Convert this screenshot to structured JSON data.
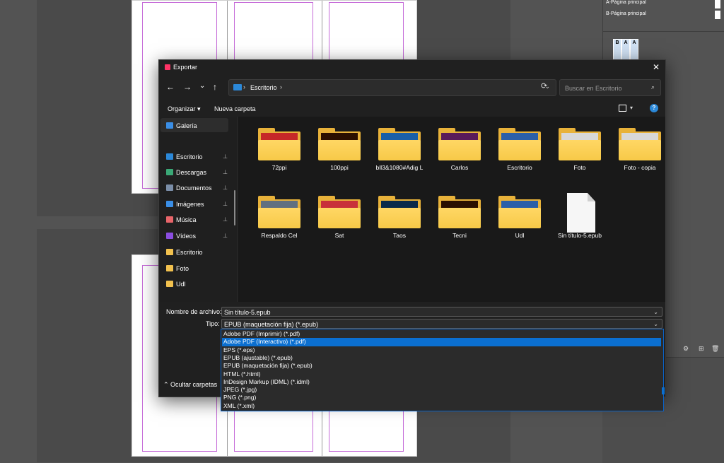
{
  "background": {
    "right_panel_rows": [
      "A-Página principal",
      "B-Página principal"
    ],
    "page_thumbs": [
      "B",
      "A",
      "A"
    ]
  },
  "dialog": {
    "title": "Exportar",
    "close": "✕",
    "nav": {
      "back": "←",
      "forward": "→",
      "recent": "⌄",
      "up": "↑"
    },
    "address": {
      "crumb": "Escritorio",
      "sep1": "›",
      "sep2": "›",
      "dropdown": "⌄",
      "refresh": "⟳"
    },
    "search": {
      "placeholder": "Buscar en Escritorio",
      "icon": "⌕"
    },
    "toolbar": {
      "organize": "Organizar ▾",
      "new_folder": "Nueva carpeta",
      "view_chev": "▾",
      "help": "?"
    },
    "sidebar": {
      "items": [
        {
          "label": "Galería",
          "pinned": false,
          "color": "#3a8ee6"
        },
        {
          "label": "Escritorio",
          "pinned": true,
          "color": "#2b88d8"
        },
        {
          "label": "Descargas",
          "pinned": true,
          "color": "#3aa876"
        },
        {
          "label": "Documentos",
          "pinned": true,
          "color": "#7b8ea8"
        },
        {
          "label": "Imágenes",
          "pinned": true,
          "color": "#3a8ee6"
        },
        {
          "label": "Música",
          "pinned": true,
          "color": "#e8656a"
        },
        {
          "label": "Vídeos",
          "pinned": true,
          "color": "#8a4de0"
        },
        {
          "label": "Escritorio",
          "pinned": false,
          "color": "#f2c14e"
        },
        {
          "label": "Foto",
          "pinned": false,
          "color": "#f2c14e"
        },
        {
          "label": "Udl",
          "pinned": false,
          "color": "#f2c14e"
        }
      ],
      "pin_glyph": "📌"
    },
    "files": [
      {
        "name": "72ppi",
        "kind": "folder",
        "thumb": "#c62828"
      },
      {
        "name": "100ppi",
        "kind": "folder",
        "thumb": "#2b0f00"
      },
      {
        "name": "bll3&1080#Adig L",
        "kind": "folder",
        "thumb": "#1a5fa8"
      },
      {
        "name": "Carlos",
        "kind": "folder",
        "thumb": "#5a1a5a"
      },
      {
        "name": "Escritorio",
        "kind": "folder",
        "thumb": "#2b5fa8"
      },
      {
        "name": "Foto",
        "kind": "folder",
        "thumb": "#d8d8d8"
      },
      {
        "name": "Foto - copia",
        "kind": "folder",
        "thumb": "#d8d8d8"
      },
      {
        "name": "Respaldo Cel",
        "kind": "folder",
        "thumb": "#607080"
      },
      {
        "name": "Sat",
        "kind": "folder",
        "thumb": "#c8303a"
      },
      {
        "name": "Taos",
        "kind": "folder",
        "thumb": "#0a2a4a"
      },
      {
        "name": "Tecni",
        "kind": "folder",
        "thumb": "#2b0f00"
      },
      {
        "name": "Udl",
        "kind": "folder",
        "thumb": "#2b5fa8"
      },
      {
        "name": "Sin título-5.epub",
        "kind": "file",
        "thumb": "#f6f6f6"
      }
    ],
    "filename_label": "Nombre de archivo:",
    "filename_value": "Sin título-5.epub",
    "type_label": "Tipo:",
    "type_value": "EPUB (maquetación fija) (*.epub)",
    "type_options": [
      "Adobe PDF (Imprimir) (*.pdf)",
      "Adobe PDF (Interactivo) (*.pdf)",
      "EPS (*.eps)",
      "EPUB (ajustable) (*.epub)",
      "EPUB (maquetación fija) (*.epub)",
      "HTML (*.html)",
      "InDesign Markup (IDML) (*.idml)",
      "JPEG (*.jpg)",
      "PNG (*.png)",
      "XML (*.xml)"
    ],
    "selected_option_index": 1,
    "hide_folders": "⌃  Ocultar carpetas",
    "chevron": "⌄"
  }
}
